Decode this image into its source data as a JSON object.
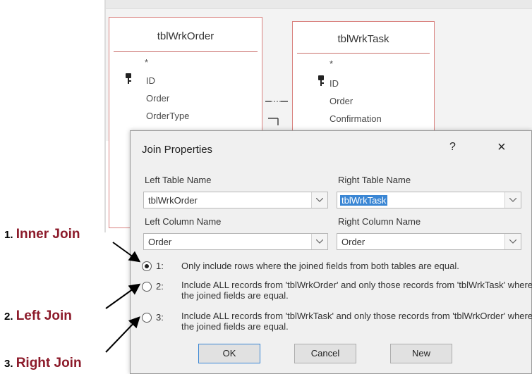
{
  "tables": [
    {
      "title": "tblWrkOrder",
      "fields": [
        "*",
        "ID",
        "Order",
        "OrderType"
      ]
    },
    {
      "title": "tblWrkTask",
      "fields": [
        "*",
        "ID",
        "Order",
        "Confirmation"
      ]
    }
  ],
  "dialog": {
    "title": "Join Properties",
    "help": "?",
    "close": "×",
    "left_table_label": "Left Table Name",
    "left_table_value": "tblWrkOrder",
    "right_table_label": "Right Table Name",
    "right_table_value": "tblWrkTask",
    "left_column_label": "Left Column Name",
    "left_column_value": "Order",
    "right_column_label": "Right Column Name",
    "right_column_value": "Order",
    "options": [
      {
        "num": "1:",
        "text": "Only include rows where the joined fields from both tables are equal.",
        "selected": true
      },
      {
        "num": "2:",
        "text": "Include ALL records from 'tblWrkOrder' and only those records from 'tblWrkTask' where the joined fields are equal.",
        "selected": false
      },
      {
        "num": "3:",
        "text": "Include ALL records from 'tblWrkTask' and only those records from 'tblWrkOrder' where the joined fields are equal.",
        "selected": false
      }
    ],
    "buttons": {
      "ok": "OK",
      "cancel": "Cancel",
      "new": "New"
    }
  },
  "annotations": [
    {
      "num": "1.",
      "text": "Inner Join"
    },
    {
      "num": "2.",
      "text": "Left Join"
    },
    {
      "num": "3.",
      "text": "Right Join"
    }
  ]
}
